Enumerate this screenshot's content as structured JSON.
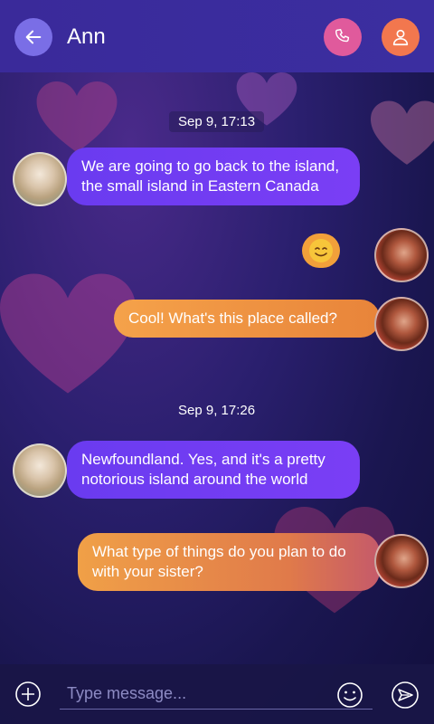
{
  "header": {
    "title": "Ann"
  },
  "messages": [
    {
      "type": "timestamp",
      "text": "Sep 9, 17:13"
    },
    {
      "type": "incoming",
      "text_line1": "We are going to go back to the island,",
      "text_line2": "the small island in Eastern Canada"
    },
    {
      "type": "outgoing-emoji",
      "emoji": "smiling-face"
    },
    {
      "type": "outgoing",
      "text": "Cool! What's this place called?"
    },
    {
      "type": "timestamp",
      "text": "Sep 9, 17:26"
    },
    {
      "type": "incoming",
      "text_line1": "Newfoundland. Yes, and it's a pretty",
      "text_line2": "notorious island around the world"
    },
    {
      "type": "outgoing",
      "text_line1": "What type of things do you plan to do",
      "text_line2": "with your sister?"
    }
  ],
  "input": {
    "placeholder": "Type message..."
  },
  "colors": {
    "incoming_bubble": "#6a3bf0",
    "outgoing_bubble": "#f5a24a",
    "call_button": "#e05a9c",
    "profile_button": "#f2774e"
  }
}
